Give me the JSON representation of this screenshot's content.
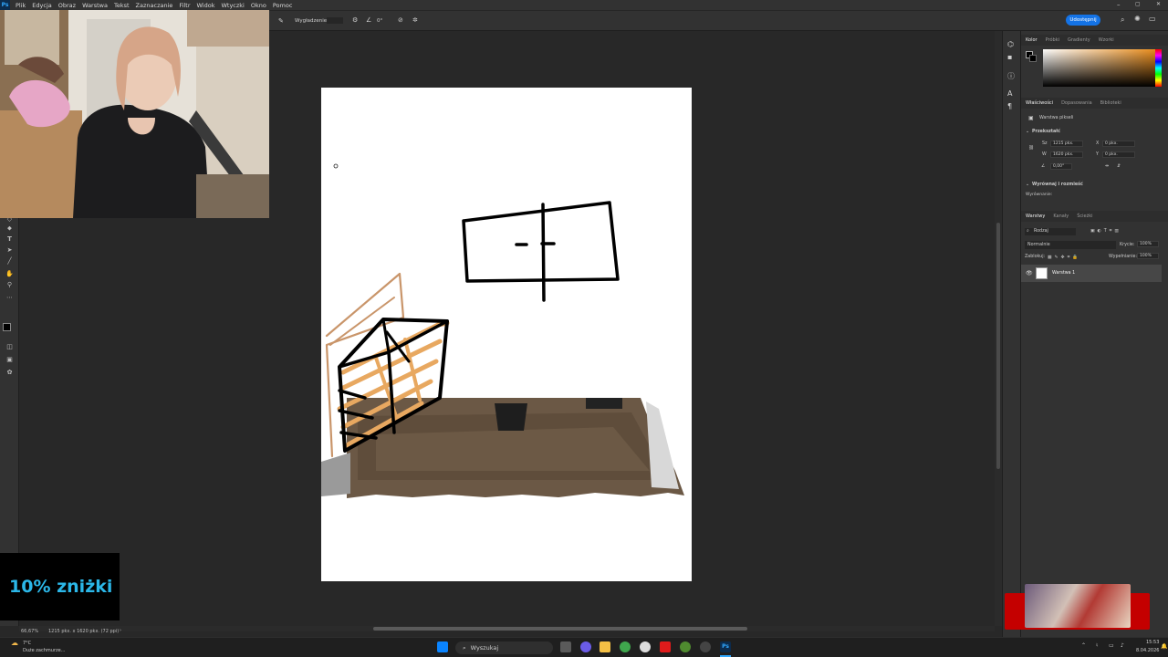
{
  "menu": {
    "items": [
      "Plik",
      "Edycja",
      "Obraz",
      "Warstwa",
      "Tekst",
      "Zaznaczanie",
      "Filtr",
      "Widok",
      "Wtyczki",
      "Okno",
      "Pomoc"
    ]
  },
  "options": {
    "smoothing_label": "Wygładzenie:",
    "angle_value": "0°"
  },
  "header": {
    "share_label": "Udostępnij"
  },
  "color_panel": {
    "tabs": [
      "Kolor",
      "Próbki",
      "Gradienty",
      "Wzorki"
    ]
  },
  "properties_panel": {
    "tabs": [
      "Właściwości",
      "Dopasowania",
      "Biblioteki"
    ],
    "layer_type": "Warstwa pikseli",
    "transform_header": "Przekształć",
    "width_label": "Sz",
    "width_value": "1215 pkx.",
    "height_label": "W",
    "height_value": "1620 pkx.",
    "x_label": "X",
    "x_value": "0 pkx.",
    "y_label": "Y",
    "y_value": "0 pkx.",
    "angle_value": "0,00°",
    "align_header": "Wyrównaj i rozmieść",
    "align_sub": "Wyrównanie:"
  },
  "layers_panel": {
    "tabs": [
      "Warstwy",
      "Kanały",
      "Ścieżki"
    ],
    "filter_label": "Rodzaj",
    "blend_mode": "Normalnie",
    "opacity_label": "Krycie:",
    "opacity_value": "100%",
    "lock_label": "Zablokuj:",
    "fill_label": "Wypełnianie:",
    "fill_value": "100%",
    "layers": [
      {
        "name": "Warstwa 1"
      }
    ]
  },
  "status": {
    "zoom": "66,67%",
    "doc_info": "1215 pkx. x 1620 pkx. (72 ppi)"
  },
  "promo": {
    "text": "10% zniżki"
  },
  "taskbar": {
    "weather_temp": "7°C",
    "weather_desc": "Duże zachmurze...",
    "search_label": "Wyszukaj",
    "time": "15:53",
    "date": "8.04.2026"
  },
  "colors": {
    "accent_blue": "#1473e6",
    "ps_blue": "#31a8ff",
    "promo_text": "#2bb7e8",
    "sketch_orange": "#e8a860",
    "sketch_brown": "#c9956a"
  }
}
